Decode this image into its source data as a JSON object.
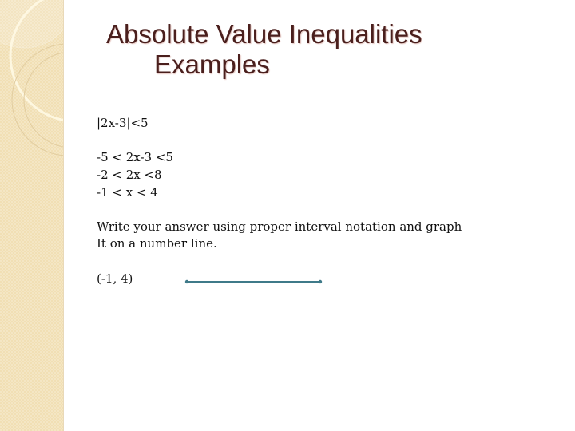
{
  "slide": {
    "title_line1": "Absolute Value Inequalities",
    "title_line2": "Examples",
    "problem": "|2x-3|<5",
    "steps": [
      "-5 < 2x-3 <5",
      "-2 < 2x <8",
      "-1 < x < 4"
    ],
    "instruction_line1": "Write your answer using proper interval notation and graph",
    "instruction_line2": "It on a number line.",
    "answer": "(-1, 4)",
    "number_line": {
      "from": -1,
      "to": 4,
      "color": "#3f7a89"
    }
  }
}
